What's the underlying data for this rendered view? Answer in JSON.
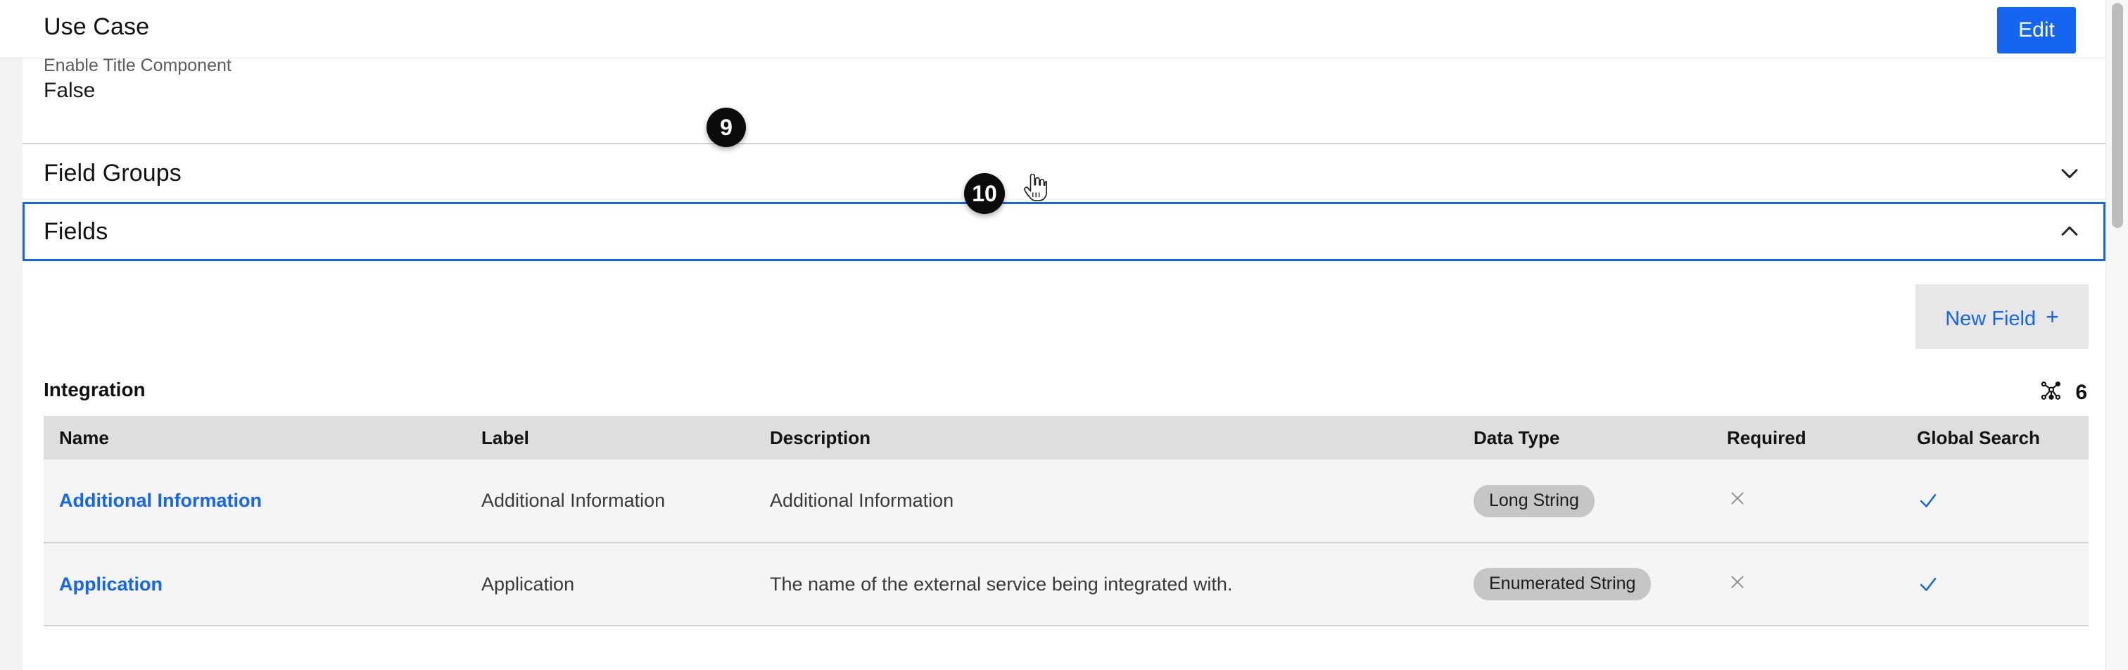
{
  "header": {
    "title": "Use Case",
    "edit_label": "Edit"
  },
  "detail": {
    "label": "Enable Title Component",
    "value": "False"
  },
  "sections": [
    {
      "title": "Field Groups",
      "icon": "chevron-down-icon",
      "expanded": false
    },
    {
      "title": "Fields",
      "icon": "chevron-up-icon",
      "expanded": true
    }
  ],
  "fields_panel": {
    "new_field_label": "New Field",
    "new_field_plus": "+",
    "group_title": "Integration",
    "relationship_icon": "graph-nodes-icon",
    "relationship_count": "6",
    "columns": [
      "Name",
      "Label",
      "Description",
      "Data Type",
      "Required",
      "Global Search"
    ],
    "rows": [
      {
        "name": "Additional Information",
        "label": "Additional Information",
        "description": "Additional Information",
        "data_type": "Long String",
        "required": "×",
        "required_icon": "close-icon",
        "global_search": "✓",
        "global_search_icon": "check-icon"
      },
      {
        "name": "Application",
        "label": "Application",
        "description": "The name of the external service being integrated with.",
        "data_type": "Enumerated String",
        "required": "×",
        "required_icon": "close-icon",
        "global_search": "✓",
        "global_search_icon": "check-icon"
      }
    ]
  },
  "step_badges": [
    {
      "number": "9"
    },
    {
      "number": "10"
    }
  ],
  "colors": {
    "accent_blue": "#1565f0",
    "badge_black": "#0b0b0b",
    "chip_gray": "#c6c6c6",
    "table_header_gray": "#dedede",
    "row_gray": "#f5f5f5",
    "hover_gray": "#e7e7e7",
    "check_blue": "#1565f0",
    "x_gray": "#8d8d8d"
  }
}
